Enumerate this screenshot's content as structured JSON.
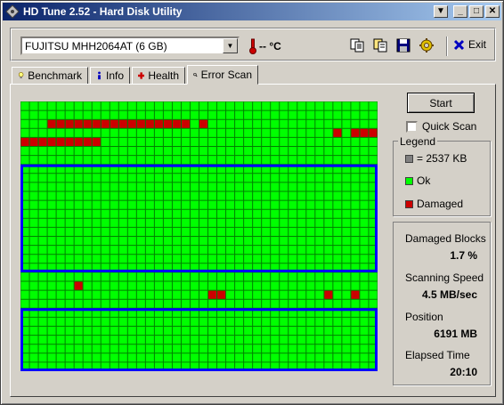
{
  "window": {
    "title": "HD Tune 2.52 - Hard Disk Utility"
  },
  "titlebar_buttons": {
    "menu": "▼",
    "minimize": "_",
    "maximize": "□",
    "close": "✕"
  },
  "toolbar": {
    "drive": "FUJITSU MHH2064AT (6 GB)",
    "temperature": "-- °C",
    "exit_label": "Exit",
    "icons": [
      "copy-icon",
      "copy-all-icon",
      "save-icon",
      "options-icon"
    ]
  },
  "tabs": [
    {
      "label": "Benchmark",
      "icon": "benchmark-icon",
      "active": false
    },
    {
      "label": "Info",
      "icon": "info-icon",
      "active": false
    },
    {
      "label": "Health",
      "icon": "health-icon",
      "active": false
    },
    {
      "label": "Error Scan",
      "icon": "error-scan-icon",
      "active": true
    }
  ],
  "scan": {
    "start_label": "Start",
    "quick_scan_label": "Quick Scan",
    "quick_scan_checked": false,
    "grid_columns": 40,
    "grid_rows": 30,
    "damaged_cells": [
      [
        3,
        2
      ],
      [
        4,
        2
      ],
      [
        5,
        2
      ],
      [
        6,
        2
      ],
      [
        7,
        2
      ],
      [
        8,
        2
      ],
      [
        9,
        2
      ],
      [
        10,
        2
      ],
      [
        11,
        2
      ],
      [
        12,
        2
      ],
      [
        13,
        2
      ],
      [
        14,
        2
      ],
      [
        15,
        2
      ],
      [
        16,
        2
      ],
      [
        17,
        2
      ],
      [
        18,
        2
      ],
      [
        20,
        2
      ],
      [
        35,
        3
      ],
      [
        37,
        3
      ],
      [
        38,
        3
      ],
      [
        39,
        3
      ],
      [
        0,
        4
      ],
      [
        1,
        4
      ],
      [
        2,
        4
      ],
      [
        3,
        4
      ],
      [
        4,
        4
      ],
      [
        5,
        4
      ],
      [
        6,
        4
      ],
      [
        7,
        4
      ],
      [
        8,
        4
      ],
      [
        6,
        20
      ],
      [
        21,
        21
      ],
      [
        22,
        21
      ],
      [
        34,
        21
      ],
      [
        37,
        21
      ]
    ],
    "scanning_blocks": [
      {
        "row_start": 7,
        "row_end": 18
      },
      {
        "row_start": 23,
        "row_end": 29
      }
    ]
  },
  "legend": {
    "title": "Legend",
    "block_size": "= 2537 KB",
    "ok": "Ok",
    "damaged": "Damaged",
    "colors": {
      "block": "#808080",
      "ok": "#00ff00",
      "damaged": "#cc0000",
      "scan_outline": "#0000ff"
    }
  },
  "stats": {
    "damaged_blocks_label": "Damaged Blocks",
    "damaged_blocks_value": "1.7 %",
    "speed_label": "Scanning Speed",
    "speed_value": "4.5 MB/sec",
    "position_label": "Position",
    "position_value": "6191 MB",
    "elapsed_label": "Elapsed Time",
    "elapsed_value": "20:10"
  }
}
